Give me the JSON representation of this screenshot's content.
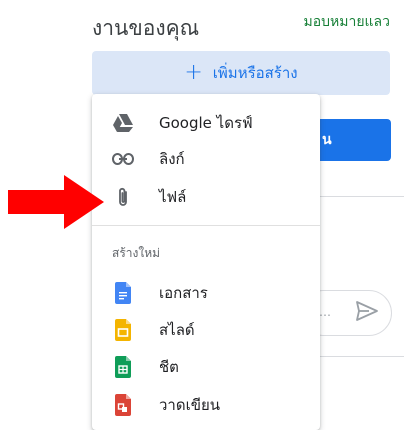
{
  "header": {
    "title": "งานของคุณ",
    "assigned_link": "มอบหมายแลว"
  },
  "add_create": {
    "label": "เพิ่มหรือสร้าง",
    "icon": "plus-icon",
    "color": "#1a73e8"
  },
  "background": {
    "button_label": "น",
    "send_icon": "send-icon"
  },
  "menu": {
    "attach_items": [
      {
        "label": "Google ไดรฟ์",
        "icon": "google-drive-icon"
      },
      {
        "label": "ลิงก์",
        "icon": "link-icon"
      },
      {
        "label": "ไฟล์",
        "icon": "paperclip-icon"
      }
    ],
    "create_section_label": "สร้างใหม่",
    "create_items": [
      {
        "label": "เอกสาร",
        "icon": "google-docs-icon",
        "color": "#4285f4"
      },
      {
        "label": "สไลด์",
        "icon": "google-slides-icon",
        "color": "#f4b400"
      },
      {
        "label": "ชีต",
        "icon": "google-sheets-icon",
        "color": "#0f9d58"
      },
      {
        "label": "วาดเขียน",
        "icon": "google-drawings-icon",
        "color": "#db4437"
      }
    ]
  },
  "annotation": {
    "arrow_icon": "red-arrow-icon",
    "arrow_color": "#ff0000"
  }
}
